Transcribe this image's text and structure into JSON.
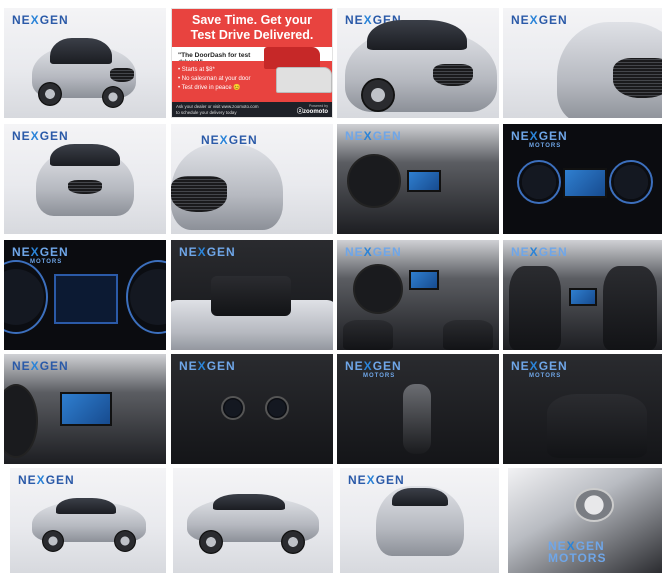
{
  "gallery": {
    "logo": {
      "prefix": "NE",
      "x": "X",
      "suffix": "GEN",
      "sub": "MOTORS"
    },
    "ad": {
      "headline_line1": "Save Time. Get your",
      "headline_line2": "Test Drive Delivered.",
      "quote": "\"The DoorDash for test drives!\"",
      "bullets": [
        "Starts at $8*",
        "No salesman at your door",
        "Test drive in peace 😊"
      ],
      "link": "Based on Pro pricing",
      "cta_line1": "Ask your dealer or visit www.zoomoto.com",
      "cta_line2": "to schedule your delivery today",
      "powered_by": "Powered by",
      "brand": "ⓩzoomoto"
    },
    "colors": {
      "ad_red": "#e8433f",
      "logo_blue": "#2b5aa8"
    }
  }
}
